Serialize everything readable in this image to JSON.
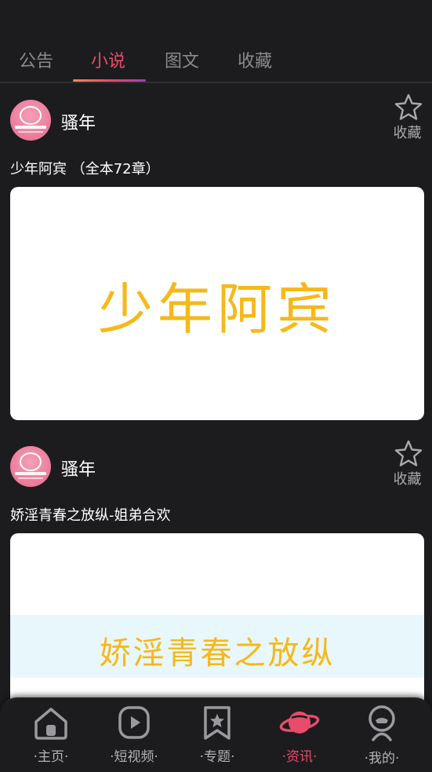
{
  "tabs": [
    {
      "label": "公告",
      "active": false
    },
    {
      "label": "小说",
      "active": true
    },
    {
      "label": "图文",
      "active": false
    },
    {
      "label": "收藏",
      "active": false
    }
  ],
  "posts": [
    {
      "author": "骚年",
      "favorite_label": "收藏",
      "title": "少年阿宾 （全本72章）",
      "cover_text": "少年阿宾"
    },
    {
      "author": "骚年",
      "favorite_label": "收藏",
      "title": "娇淫青春之放纵-姐弟合欢",
      "cover_text": "娇淫青春之放纵"
    }
  ],
  "bottom_nav": [
    {
      "label": "·主页·",
      "icon": "home-icon",
      "active": false
    },
    {
      "label": "·短视频·",
      "icon": "play-icon",
      "active": false
    },
    {
      "label": "·专题·",
      "icon": "bookmark-star-icon",
      "active": false
    },
    {
      "label": "·资讯·",
      "icon": "planet-icon",
      "active": true
    },
    {
      "label": "·我的·",
      "icon": "profile-icon",
      "active": false
    }
  ],
  "colors": {
    "accent": "#e94b6a",
    "background": "#1c1c1e",
    "cover_text": "#f6b81a"
  }
}
